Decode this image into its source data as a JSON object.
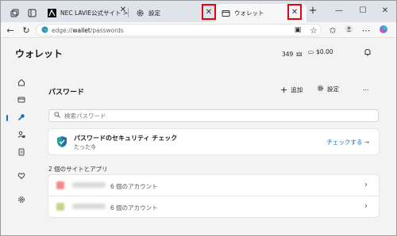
{
  "tabs": [
    {
      "label": "",
      "icon": "collections-icon"
    },
    {
      "label": "",
      "icon": "tab-actions-icon"
    },
    {
      "label": "NEC LAVIE公式サイト >",
      "icon": "nec-favicon"
    },
    {
      "label": "設定",
      "icon": "gear-icon"
    },
    {
      "label": "ウォレット",
      "icon": "wallet-icon",
      "active": true
    }
  ],
  "address": {
    "prefix": "edge://",
    "bold": "wallet",
    "suffix": "/passwords"
  },
  "page": {
    "title": "ウォレット",
    "points": "349",
    "balance": "$0.00"
  },
  "section": {
    "title": "パスワード",
    "add_label": "追加",
    "settings_label": "設定",
    "more": "…"
  },
  "search": {
    "placeholder": "検索パスワード"
  },
  "security_check": {
    "title": "パスワードのセキュリティ チェック",
    "subtitle": "たった今",
    "action": "チェックする →"
  },
  "sites": {
    "title": "2 個のサイトとアプリ",
    "items": [
      {
        "count_label": "6 個のアカウント",
        "favicon_color": "#f28b8b"
      },
      {
        "count_label": "6 個のアカウント",
        "favicon_color": "#c9d48a"
      }
    ]
  },
  "colors": {
    "accent": "#0f6cbd",
    "highlight": "#e60012",
    "tabstrip": "#dfe3ea"
  }
}
